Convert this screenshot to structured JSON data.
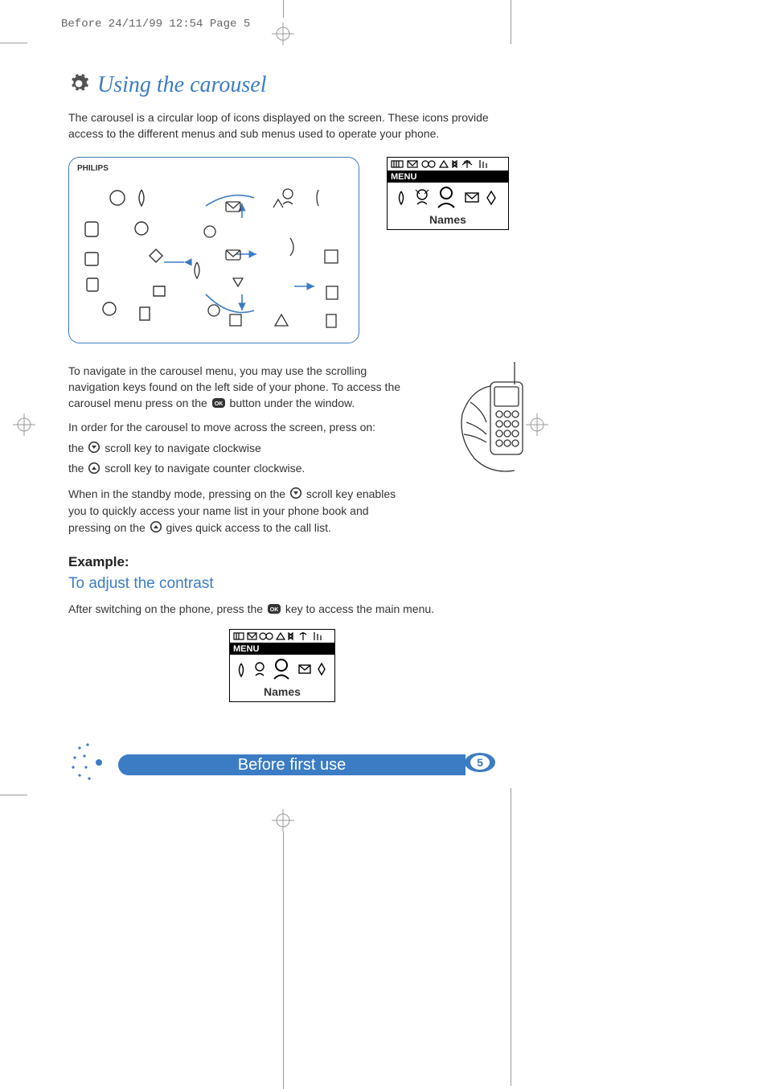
{
  "header": "Before  24/11/99 12:54  Page 5",
  "title": "Using the carousel",
  "intro": "The carousel is a circular loop of icons displayed on the screen.  These icons provide access to the different menus and sub menus used to operate your phone.",
  "brand": "PHILIPS",
  "screen": {
    "menu_label": "MENU",
    "item_label": "Names"
  },
  "nav": {
    "p1": "To navigate in the carousel menu, you may use the scrolling navigation keys found on the left side of your phone.  To access the carousel menu press on the ",
    "p1b": " button under the window.",
    "p2": "In order for the carousel to move across the screen, press on:",
    "l1a": "the ",
    "l1b": " scroll key to navigate clockwise",
    "l2a": "the ",
    "l2b": " scroll key to navigate counter clockwise.",
    "p3a": "When in the standby mode, pressing on the ",
    "p3b": " scroll key enables you to quickly access your name list in your phone book and pressing on the ",
    "p3c": " gives quick access to the call list."
  },
  "example": {
    "heading": "Example:",
    "subheading": "To adjust the contrast",
    "text_a": "After switching on the phone, press the ",
    "text_b": " key to access the main menu."
  },
  "footer": {
    "label": "Before first use",
    "page": "5"
  }
}
